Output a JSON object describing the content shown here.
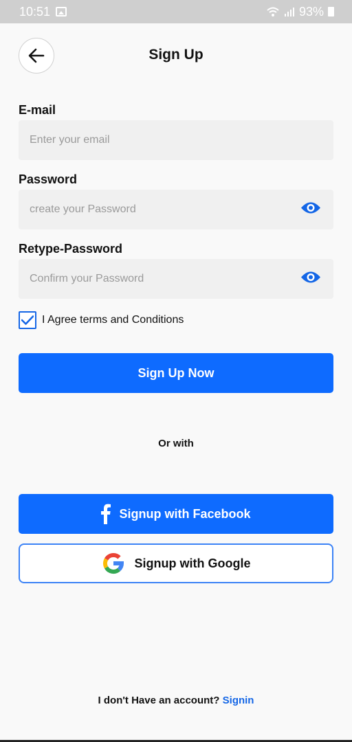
{
  "status_bar": {
    "time": "10:51",
    "battery": "93%"
  },
  "header": {
    "title": "Sign Up"
  },
  "form": {
    "email": {
      "label": "E-mail",
      "value": "",
      "placeholder": "Enter your email"
    },
    "password": {
      "label": "Password",
      "value": "",
      "placeholder": "create your Password"
    },
    "retype_password": {
      "label": "Retype-Password",
      "value": "",
      "placeholder": "Confirm your Password"
    },
    "agree": {
      "label": "I Agree terms and Conditions",
      "checked": true
    }
  },
  "buttons": {
    "signup": "Sign Up Now",
    "or_with": "Or with",
    "facebook": "Signup with Facebook",
    "google": "Signup with Google"
  },
  "footer": {
    "text": "I don't Have an account?",
    "link": "Signin"
  },
  "colors": {
    "primary": "#0e6bff",
    "link": "#1466e6",
    "background": "#f9f9f9",
    "input_bg": "#f0f0f0"
  },
  "icons": [
    "gallery-icon",
    "wifi-icon",
    "signal-icon",
    "battery-icon",
    "back-arrow-icon",
    "eye-icon",
    "checkmark-icon",
    "facebook-icon",
    "google-icon"
  ]
}
